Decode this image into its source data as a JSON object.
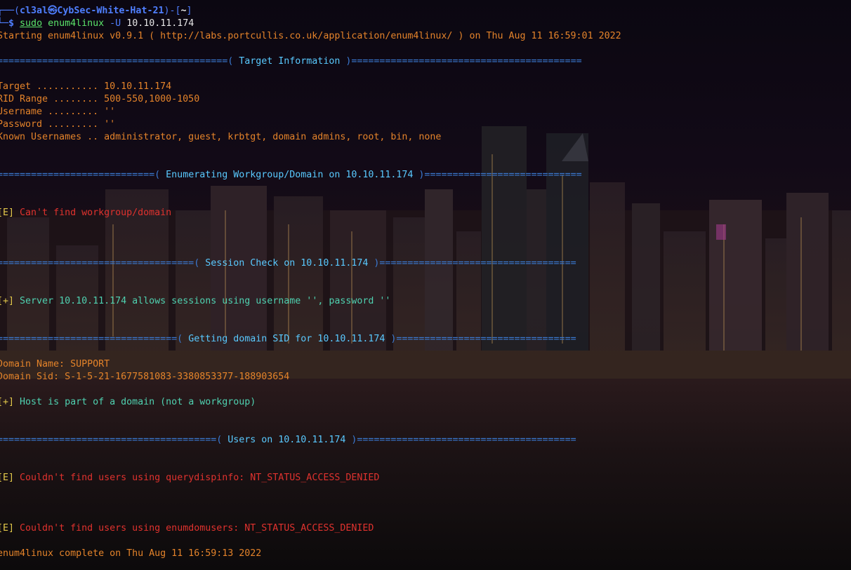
{
  "prompt": {
    "corner_top": "┌──(",
    "user": "cl3al",
    "at_symbol": "㉿",
    "host": "CybSec-White-Hat-21",
    "mid": ")-[",
    "cwd": "~",
    "end": "]",
    "corner_bottom": "└─",
    "dollar": "$",
    "cmd": "sudo",
    "tool": "enum4linux",
    "flag": "-U",
    "arg": "10.10.11.174"
  },
  "start_line": "Starting enum4linux v0.9.1 ( http://labs.portcullis.co.uk/application/enum4linux/ ) on Thu Aug 11 16:59:01 2022",
  "sections": {
    "target_info": {
      "left": "=========================================( ",
      "title": "Target Information",
      "right": " )========================================="
    },
    "workgroup": {
      "left": "============================( ",
      "title": "Enumerating Workgroup/Domain on 10.10.11.174",
      "right": " )============================"
    },
    "session": {
      "left": "===================================( ",
      "title": "Session Check on 10.10.11.174",
      "right": " )==================================="
    },
    "domain_sid": {
      "left": "================================( ",
      "title": "Getting domain SID for 10.10.11.174",
      "right": " )================================"
    },
    "users": {
      "left": "=======================================( ",
      "title": "Users on 10.10.11.174",
      "right": " )======================================="
    }
  },
  "target": {
    "target": "Target ........... 10.10.11.174",
    "rid_range": "RID Range ........ 500-550,1000-1050",
    "username": "Username ......... ''",
    "password": "Password ......... ''",
    "known_users": "Known Usernames .. administrator, guest, krbtgt, domain admins, root, bin, none"
  },
  "messages": {
    "wg_tag": "[E]",
    "wg_text": " Can't find workgroup/domain",
    "session_tag": "[+]",
    "session_text": " Server 10.10.11.174 allows sessions using username '', password ''",
    "domain_name": "Domain Name: SUPPORT",
    "domain_sid": "Domain Sid: S-1-5-21-1677581083-3380853377-188903654",
    "host_tag": "[+]",
    "host_text": " Host is part of a domain (not a workgroup)",
    "users_err1_tag": "[E]",
    "users_err1_text": " Couldn't find users using querydispinfo: NT_STATUS_ACCESS_DENIED",
    "users_err2_tag": "[E]",
    "users_err2_text": " Couldn't find users using enumdomusers: NT_STATUS_ACCESS_DENIED",
    "complete": "enum4linux complete on Thu Aug 11 16:59:13 2022"
  },
  "colors": {
    "prompt_blue": "#4f7fff",
    "separator_blue": "#3b7bd6",
    "section_title": "#59c9ff",
    "info_orange": "#e4832a",
    "error_red": "#e0322e",
    "success_teal": "#4fd1b0",
    "tag_yellow": "#e2c84a"
  }
}
